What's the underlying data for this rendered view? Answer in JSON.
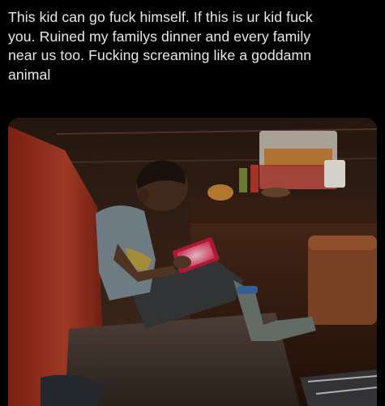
{
  "post": {
    "text": "This kid can go fuck himself. If this is ur kid fuck\nyou. Ruined my familys dinner and every family\nnear us too. Fucking screaming like a goddamn\nanimal"
  },
  "media": {
    "icon": "photo",
    "description_colors": {
      "booth_red": "#a8321f",
      "wall_wood": "#3a2519",
      "seat_leather": "#4a3b33",
      "shirt": "#7f8c96",
      "tablet_screen": "#e9446a"
    }
  }
}
